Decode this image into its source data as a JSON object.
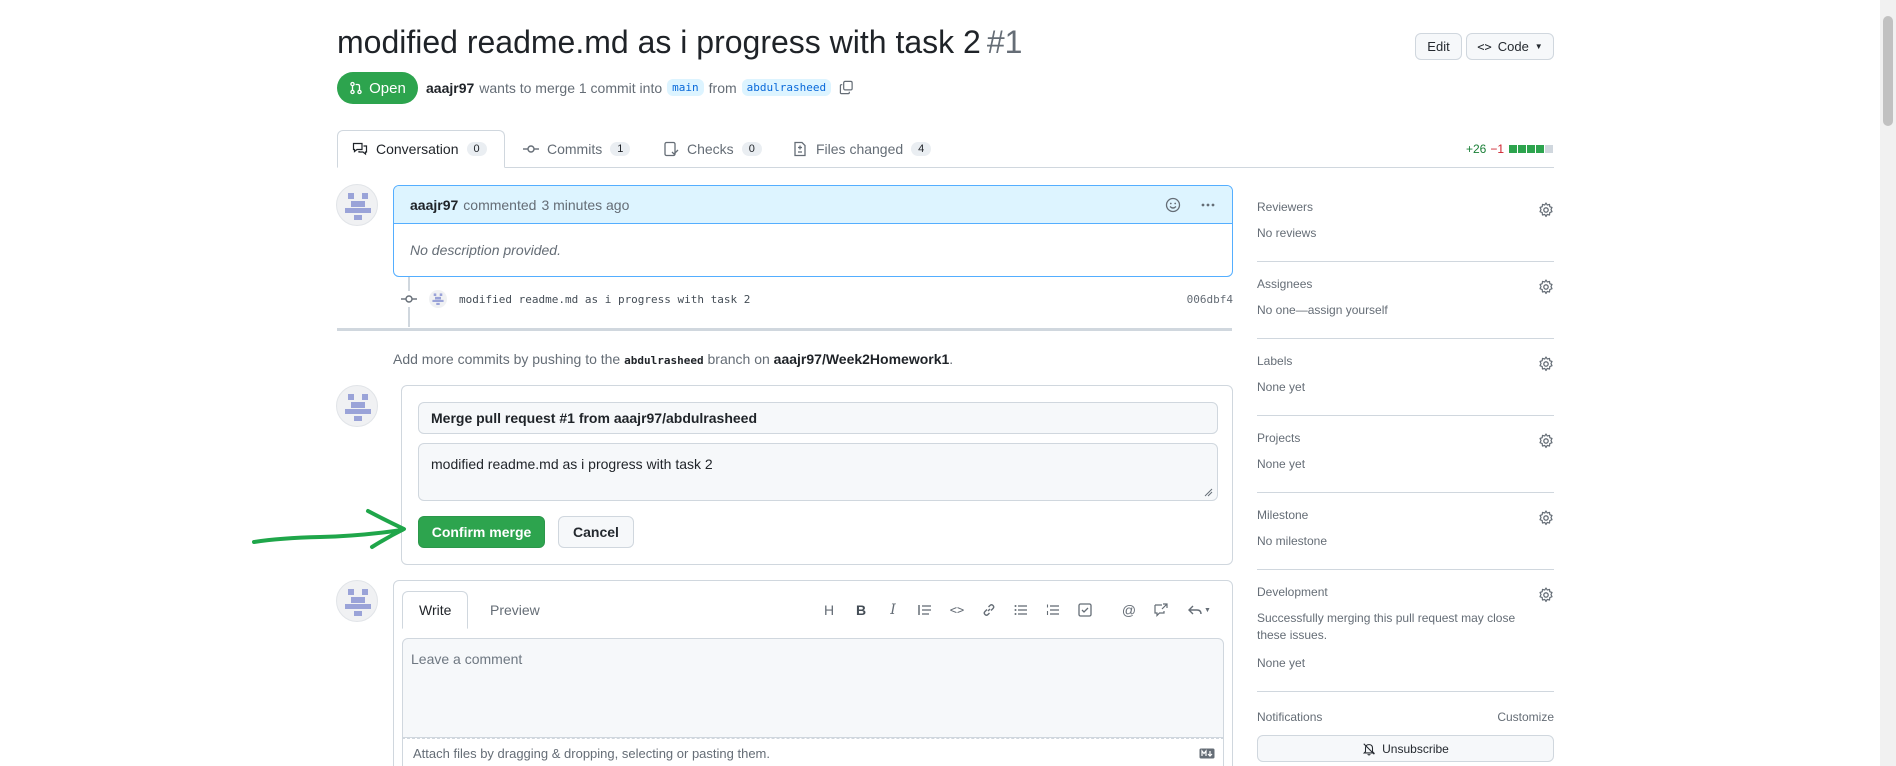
{
  "header": {
    "title": "modified readme.md as i progress with task 2",
    "number": "#1",
    "edit_label": "Edit",
    "code_label": "Code",
    "state": "Open",
    "author": "aaajr97",
    "merge_text": "wants to merge 1 commit into",
    "base_branch": "main",
    "from_text": "from",
    "head_branch": "abdulrasheed"
  },
  "tabs": [
    {
      "label": "Conversation",
      "count": "0"
    },
    {
      "label": "Commits",
      "count": "1"
    },
    {
      "label": "Checks",
      "count": "0"
    },
    {
      "label": "Files changed",
      "count": "4"
    }
  ],
  "diffstat": {
    "additions": "+26",
    "deletions": "−1"
  },
  "comment": {
    "author": "aaajr97",
    "action": "commented",
    "time": "3 minutes ago",
    "body": "No description provided."
  },
  "commit": {
    "message": "modified readme.md as i progress with task 2",
    "sha": "006dbf4"
  },
  "push_hint": {
    "prefix": "Add more commits by pushing to the",
    "branch": "abdulrasheed",
    "middle": "branch on",
    "repo": "aaajr97/Week2Homework1",
    "suffix": "."
  },
  "merge": {
    "title_value": "Merge pull request #1 from aaajr97/abdulrasheed",
    "body_value": "modified readme.md as i progress with task 2",
    "confirm_label": "Confirm merge",
    "cancel_label": "Cancel"
  },
  "editor": {
    "write_tab": "Write",
    "preview_tab": "Preview",
    "placeholder": "Leave a comment",
    "attach_text": "Attach files by dragging & dropping, selecting or pasting them."
  },
  "sidebar": {
    "reviewers": {
      "title": "Reviewers",
      "value": "No reviews"
    },
    "assignees": {
      "title": "Assignees",
      "value": "No one—assign yourself"
    },
    "labels": {
      "title": "Labels",
      "value": "None yet"
    },
    "projects": {
      "title": "Projects",
      "value": "None yet"
    },
    "milestone": {
      "title": "Milestone",
      "value": "No milestone"
    },
    "development": {
      "title": "Development",
      "desc": "Successfully merging this pull request may close these issues.",
      "value": "None yet"
    },
    "notifications": {
      "title": "Notifications",
      "customize": "Customize",
      "unsubscribe": "Unsubscribe"
    }
  },
  "colors": {
    "primary_green": "#2da44e",
    "link_blue": "#0969da",
    "annotation_arrow": "#1fa64a"
  }
}
